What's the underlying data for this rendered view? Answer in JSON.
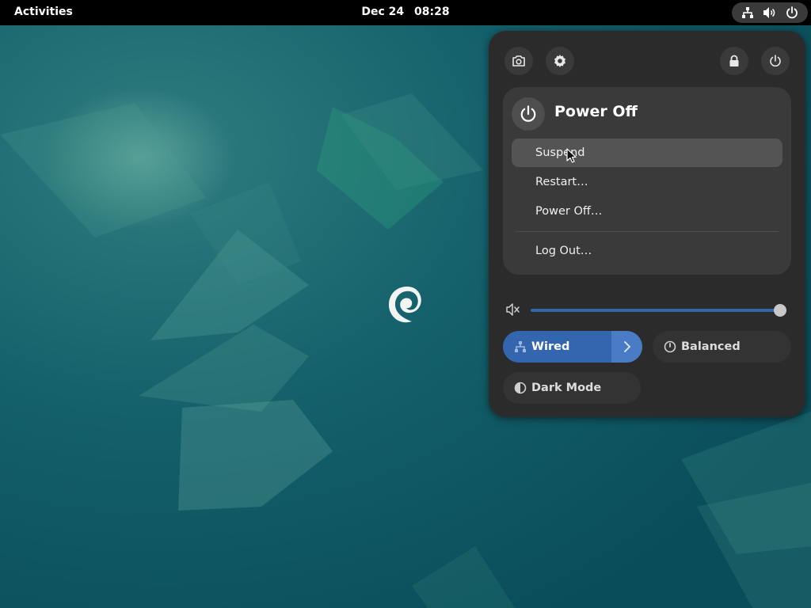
{
  "topbar": {
    "activities_label": "Activities",
    "date": "Dec 24",
    "time": "08:28",
    "tray_icons": [
      "network-wired-icon",
      "volume-icon",
      "power-icon"
    ]
  },
  "quick_settings": {
    "header_buttons": [
      "screenshot-icon",
      "settings-icon",
      "lock-icon",
      "power-icon"
    ],
    "power_menu": {
      "title": "Power Off",
      "items": [
        {
          "label": "Suspend",
          "highlighted": true
        },
        {
          "label": "Restart…"
        },
        {
          "label": "Power Off…"
        },
        {
          "label": "Log Out…"
        }
      ]
    },
    "volume": {
      "level_percent": 100,
      "icon": "volume-muted-icon"
    },
    "toggles": {
      "wired": {
        "label": "Wired",
        "active": true
      },
      "power_mode": {
        "label": "Balanced",
        "active": false
      },
      "dark_mode": {
        "label": "Dark Mode",
        "active": false
      }
    }
  },
  "colors": {
    "panel_bg": "#2b2b2b",
    "accent": "#3466b0",
    "wallpaper": "#0f5b66"
  }
}
